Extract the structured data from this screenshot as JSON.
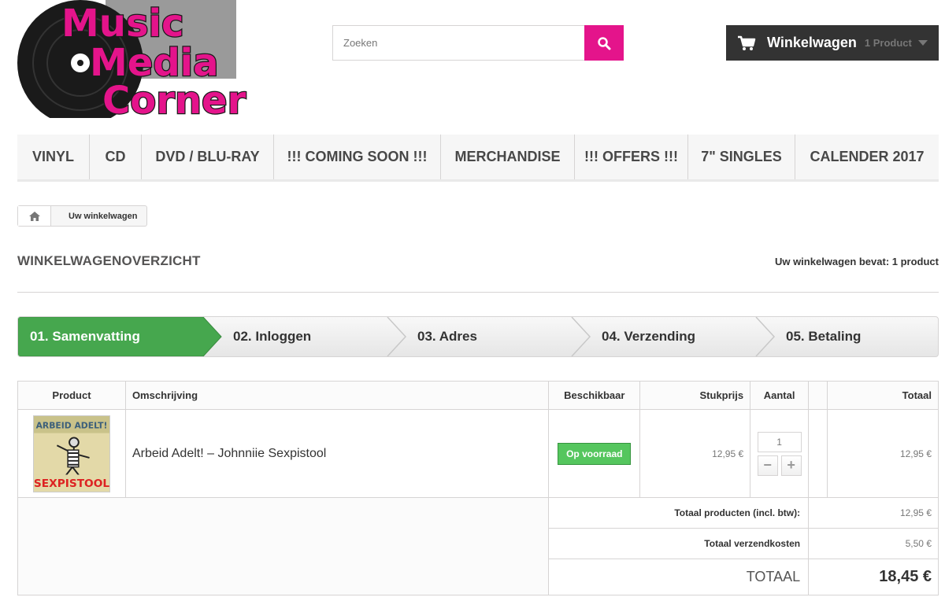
{
  "logo": {
    "line1": "Music",
    "line2": "Media",
    "line3": "Corner",
    "brand_color": "#e4148b"
  },
  "search": {
    "placeholder": "Zoeken",
    "icon": "search-icon"
  },
  "cart": {
    "label": "Winkelwagen",
    "count": "1 Product",
    "icon": "shopping-cart-icon"
  },
  "menu": {
    "items": [
      {
        "label": "VINYL"
      },
      {
        "label": "CD"
      },
      {
        "label": "DVD / BLU-RAY"
      },
      {
        "label": "!!! COMING SOON !!!"
      },
      {
        "label": "MERCHANDISE"
      },
      {
        "label": "!!! OFFERS !!!"
      },
      {
        "label": "7\" SINGLES"
      },
      {
        "label": "CALENDER 2017"
      }
    ]
  },
  "breadcrumb": {
    "home_icon": "home-icon",
    "current": "Uw winkelwagen"
  },
  "heading": {
    "title": "WINKELWAGENOVERZICHT",
    "summary": "Uw winkelwagen bevat: 1 product"
  },
  "steps": [
    {
      "label": "01. Samenvatting",
      "active": true
    },
    {
      "label": "02. Inloggen"
    },
    {
      "label": "03. Adres"
    },
    {
      "label": "04. Verzending"
    },
    {
      "label": "05. Betaling"
    }
  ],
  "table": {
    "headers": {
      "product": "Product",
      "description": "Omschrijving",
      "availability": "Beschikbaar",
      "unit_price": "Stukprijs",
      "quantity": "Aantal",
      "total": "Totaal"
    },
    "row": {
      "cover_title": "ARBEID ADELT!",
      "cover_subtitle": "SEXPISTOOL",
      "description": "Arbeid Adelt! – Johnniie Sexpistool",
      "availability": "Op voorraad",
      "unit_price": "12,95 €",
      "quantity": "1",
      "total": "12,95 €"
    },
    "summary": {
      "products_label": "Totaal producten (incl. btw):",
      "products_value": "12,95 €",
      "shipping_label": "Totaal verzendkosten",
      "shipping_value": "5,50 €",
      "total_label": "TOTAAL",
      "total_value": "18,45 €"
    }
  },
  "colors": {
    "accent": "#e4148b",
    "active_step": "#46a74e",
    "in_stock": "#55c65e"
  }
}
